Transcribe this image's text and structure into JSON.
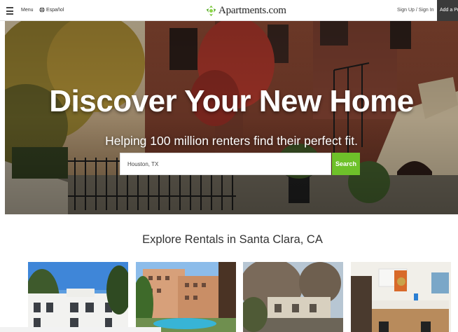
{
  "header": {
    "menu_label": "Menu",
    "language_label": "Español",
    "logo_text": "Apartments.com",
    "sign_in_label": "Sign Up / Sign In",
    "add_property_label": "Add a Pro"
  },
  "hero": {
    "title": "Discover Your New Home",
    "subtitle": "Helping 100 million renters find their perfect fit.",
    "search": {
      "value": "Houston, TX",
      "button_label": "Search"
    }
  },
  "explore": {
    "title": "Explore Rentals in Santa Clara, CA",
    "cards": [
      {
        "name": "white-apartment-building"
      },
      {
        "name": "pool-apartment-complex"
      },
      {
        "name": "townhouse-street"
      },
      {
        "name": "apartment-kitchen-interior"
      }
    ]
  },
  "colors": {
    "accent_green": "#6ec12a",
    "header_dark": "#3b3b3b"
  },
  "icons": [
    "menu-icon",
    "globe-icon",
    "apartments-logo-icon"
  ]
}
